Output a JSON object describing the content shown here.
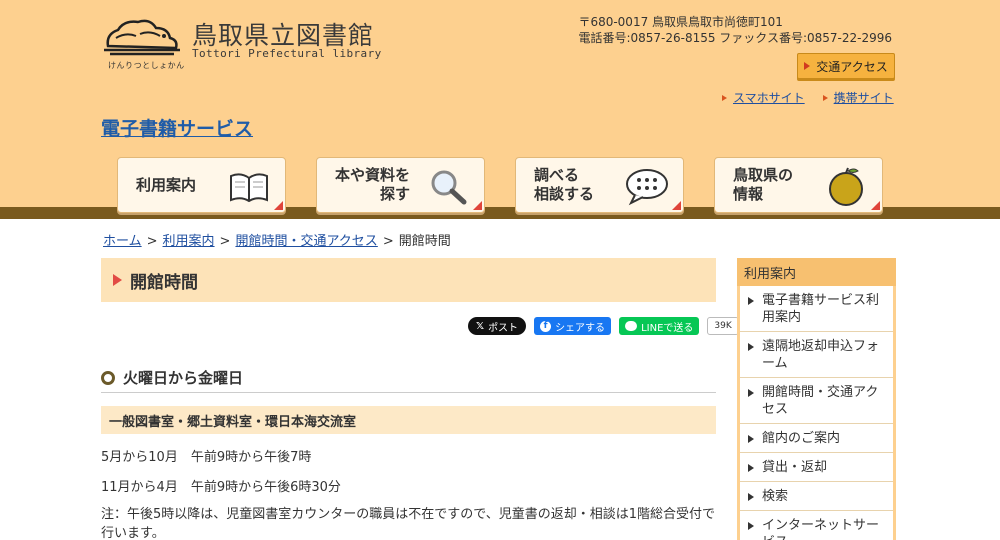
{
  "logo": {
    "title": "鳥取県立図書館",
    "subtitle": "Tottori Prefectural library",
    "kana": "けんりつとしょかん"
  },
  "address": {
    "line1": "〒680-0017 鳥取県鳥取市尚徳町101",
    "line2": "電話番号:0857-26-8155 ファックス番号:0857-22-2996"
  },
  "access_button": "交通アクセス",
  "site_links": [
    "スマホサイト",
    "携帯サイト"
  ],
  "service_title": "電子書籍サービス",
  "nav": [
    {
      "label": "利用案内",
      "icon": "open-book-icon"
    },
    {
      "label": "本や資料を\n探す",
      "icon": "magnifier-icon"
    },
    {
      "label": "調べる\n相談する",
      "icon": "speech-bubble-icon"
    },
    {
      "label": "鳥取県の\n情報",
      "icon": "pear-icon"
    }
  ],
  "breadcrumb": [
    "ホーム",
    "利用案内",
    "開館時間・交通アクセス",
    "開館時間"
  ],
  "page_title": "開館時間",
  "share": {
    "x": "ポスト",
    "facebook": "シェアする",
    "line": "LINEで送る",
    "count": "39K"
  },
  "section": {
    "heading": "火曜日から金曜日",
    "subheading": "一般図書室・郷土資料室・環日本海交流室",
    "hours1": "5月から10月　午前9時から午後7時",
    "hours2": "11月から4月　午前9時から午後6時30分",
    "note": "注：午後5時以降は、児童図書室カウンターの職員は不在ですので、児童書の返却・相談は1階総合受付で行います。"
  },
  "sidebar": {
    "heading": "利用案内",
    "items": [
      "電子書籍サービス利用案内",
      "遠隔地返却申込フォーム",
      "開館時間・交通アクセス",
      "館内のご案内",
      "貸出・返却",
      "検索",
      "インターネットサービス"
    ]
  },
  "colors": {
    "header_bg": "#fdd08f",
    "accent_brown": "#7a5a1e",
    "link_blue": "#1f4fa0",
    "heading_tri": "#e24b44"
  }
}
